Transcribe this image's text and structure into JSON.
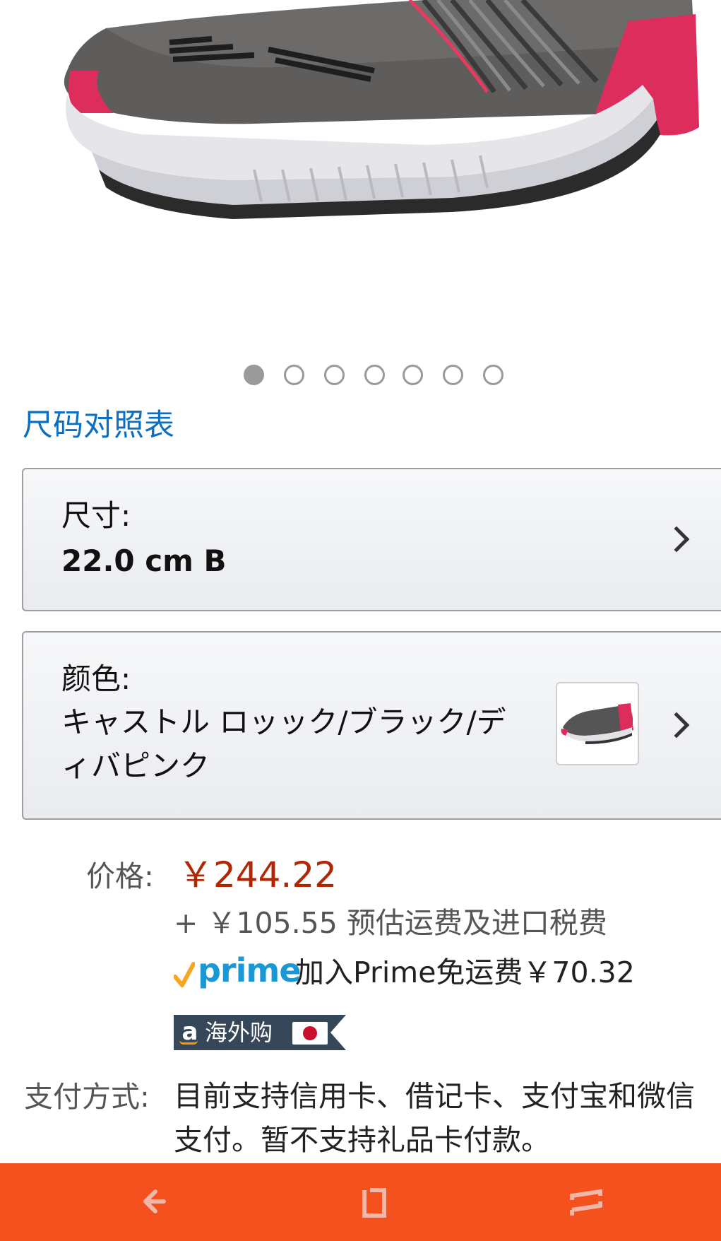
{
  "carousel": {
    "total": 7,
    "active_index": 0
  },
  "size_chart_link": "尺码对照表",
  "size_option": {
    "label": "尺寸:",
    "value": "22.0 cm B"
  },
  "color_option": {
    "label": "颜色:",
    "value": "キャストル ロッック/ブラック/ディバピンク"
  },
  "price": {
    "label": "价格:",
    "value": "￥244.22",
    "shipping": "+ ￥105.55 预估运费及进口税费",
    "prime_logo": "prime",
    "prime_text": "加入Prime免运费￥70.32",
    "badge_text": "海外购"
  },
  "payment": {
    "label": "支付方式:",
    "text": "目前支持信用卡、借记卡、支付宝和微信支付。暂不支持礼品卡付款。"
  },
  "nav": {
    "back_icon": "back-arrow-icon",
    "home_icon": "home-square-icon",
    "recent_icon": "recent-apps-icon"
  },
  "colors": {
    "link": "#0a6fc2",
    "price": "#b12704",
    "prime_blue": "#1a98d5",
    "prime_check": "#f7a51c",
    "nav_bar": "#f4511e"
  }
}
